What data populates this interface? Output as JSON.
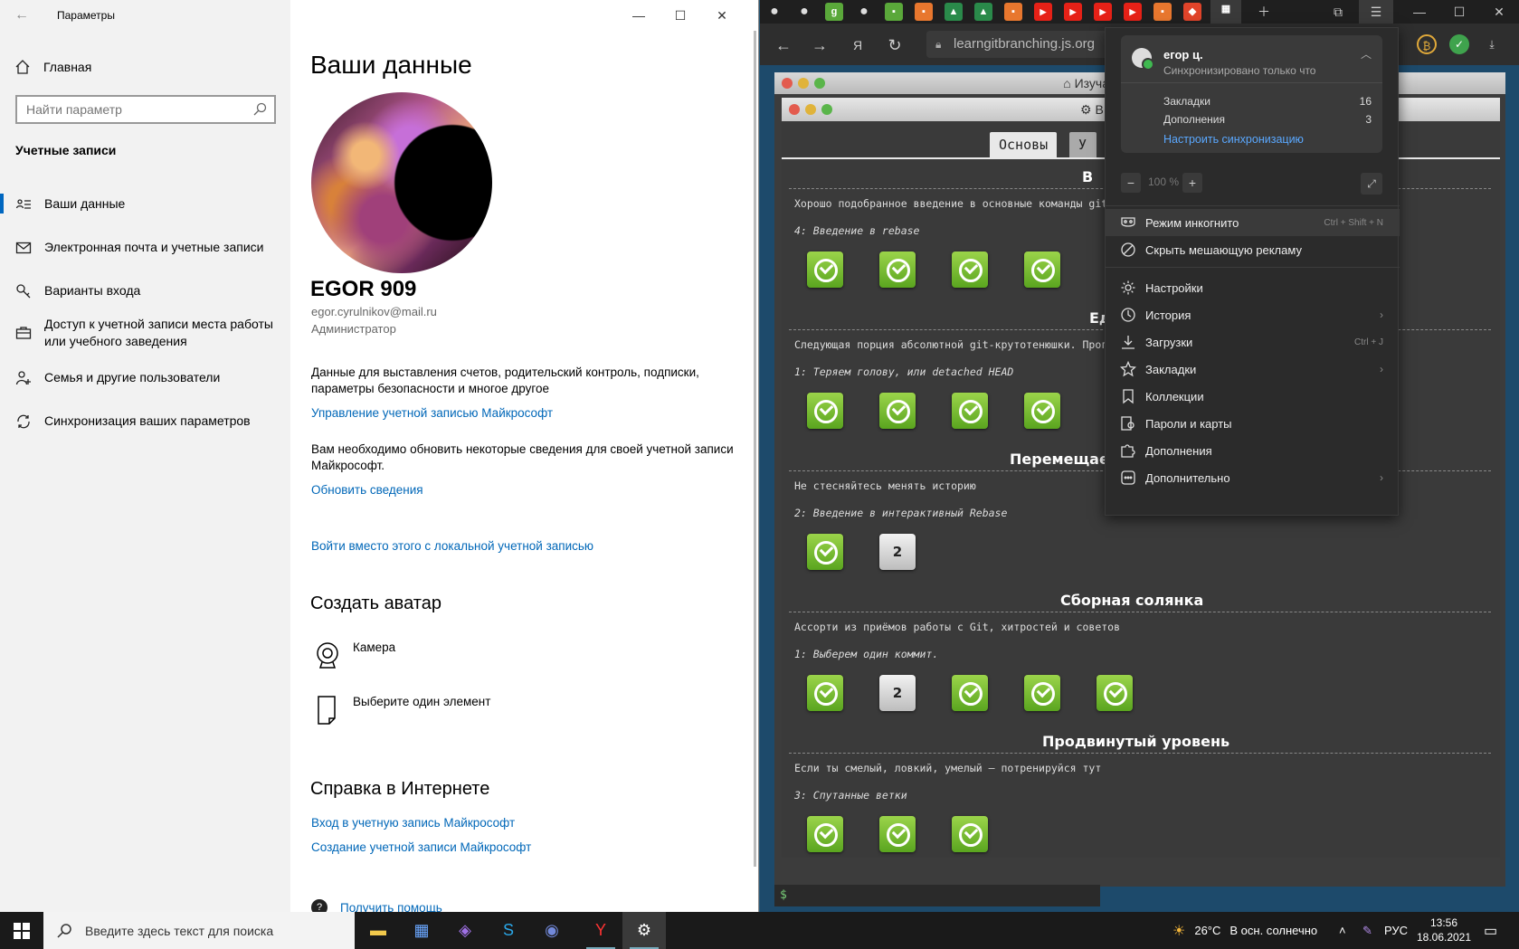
{
  "settings": {
    "window_title": "Параметры",
    "home": "Главная",
    "search_placeholder": "Найти параметр",
    "section": "Учетные записи",
    "nav": [
      {
        "label": "Ваши данные",
        "icon": "person-card-icon"
      },
      {
        "label": "Электронная почта и учетные записи",
        "icon": "mail-icon"
      },
      {
        "label": "Варианты входа",
        "icon": "key-icon"
      },
      {
        "label": "Доступ к учетной записи места работы или учебного заведения",
        "icon": "briefcase-icon"
      },
      {
        "label": "Семья и другие пользователи",
        "icon": "add-person-icon"
      },
      {
        "label": "Синхронизация ваших параметров",
        "icon": "sync-icon"
      }
    ],
    "page_title": "Ваши данные",
    "user_name": "EGOR 909",
    "user_email": "egor.cyrulnikov@mail.ru",
    "user_role": "Администратор",
    "billing_text": "Данные для выставления счетов, родительский контроль, подписки, параметры безопасности и многое другое",
    "manage_link": "Управление учетной записью Майкрософт",
    "update_text": "Вам необходимо обновить некоторые сведения для своей учетной записи Майкрософт.",
    "update_link": "Обновить сведения",
    "local_link": "Войти вместо этого с локальной учетной записью",
    "avatar_heading": "Создать аватар",
    "camera_label": "Камера",
    "choose_label": "Выберите один элемент",
    "help_heading": "Справка в Интернете",
    "help_link1": "Вход в учетную запись Майкрософт",
    "help_link2": "Создание учетной записи Майкрософт",
    "get_help": "Получить помощь"
  },
  "browser": {
    "address": "learngitbranching.js.org",
    "page": {
      "outer_title": "Изучаем ветвление в git",
      "inner_title": "Выберите уровень",
      "inner_title_visible": "В",
      "tab_main": "Основы",
      "tab_remote": "У",
      "sequences": [
        {
          "title": "В",
          "desc": "Хорошо подобранное введение в основные команды git",
          "level": "4: Введение в rebase",
          "badges": [
            "done",
            "done",
            "done",
            "done"
          ]
        },
        {
          "title": "Ед",
          "desc": "Следующая порция абсолютной git-крутотенюшки. Проголо",
          "level": "1: Теряем голову, или detached HEAD",
          "badges": [
            "done",
            "done",
            "done",
            "done"
          ]
        },
        {
          "title": "Перемещаем",
          "desc": "Не стесняйтесь менять историю",
          "level": "2: Введение в интерактивный Rebase",
          "badges": [
            "done",
            "2"
          ]
        },
        {
          "title": "Сборная солянка",
          "desc": "Ассорти из приёмов работы с Git, хитростей и советов",
          "level": "1: Выберем один коммит.",
          "badges": [
            "done",
            "2",
            "done",
            "done",
            "done"
          ]
        },
        {
          "title": "Продвинутый уровень",
          "desc": "Если ты смелый, ловкий, умелый – потренируйся тут",
          "level": "3: Спутанные ветки",
          "badges": [
            "done",
            "done",
            "done"
          ]
        }
      ],
      "terminal_prompt": "$"
    },
    "menu": {
      "user": "егор ц.",
      "sync_status": "Синхронизировано только что",
      "bookmarks_label": "Закладки",
      "bookmarks_count": "16",
      "addons_label": "Дополнения",
      "addons_count": "3",
      "configure_sync": "Настроить синхронизацию",
      "zoom": "100 %",
      "items": [
        {
          "label": "Режим инкогнито",
          "shortcut": "Ctrl + Shift + N",
          "icon": "incognito-icon"
        },
        {
          "label": "Скрыть мешающую рекламу",
          "icon": "block-icon"
        },
        {
          "label": "Настройки",
          "icon": "gear-icon"
        },
        {
          "label": "История",
          "icon": "clock-icon",
          "submenu": true
        },
        {
          "label": "Загрузки",
          "shortcut": "Ctrl + J",
          "icon": "download-icon"
        },
        {
          "label": "Закладки",
          "icon": "star-icon",
          "submenu": true
        },
        {
          "label": "Коллекции",
          "icon": "bookmark-icon"
        },
        {
          "label": "Пароли и карты",
          "icon": "key-card-icon"
        },
        {
          "label": "Дополнения",
          "icon": "puzzle-icon"
        },
        {
          "label": "Дополнительно",
          "icon": "more-icon",
          "submenu": true
        }
      ]
    }
  },
  "taskbar": {
    "search_placeholder": "Введите здесь текст для поиска",
    "weather_temp": "26°C",
    "weather_text": "В осн. солнечно",
    "lang": "РУС",
    "time": "13:56",
    "date": "18.06.2021"
  }
}
